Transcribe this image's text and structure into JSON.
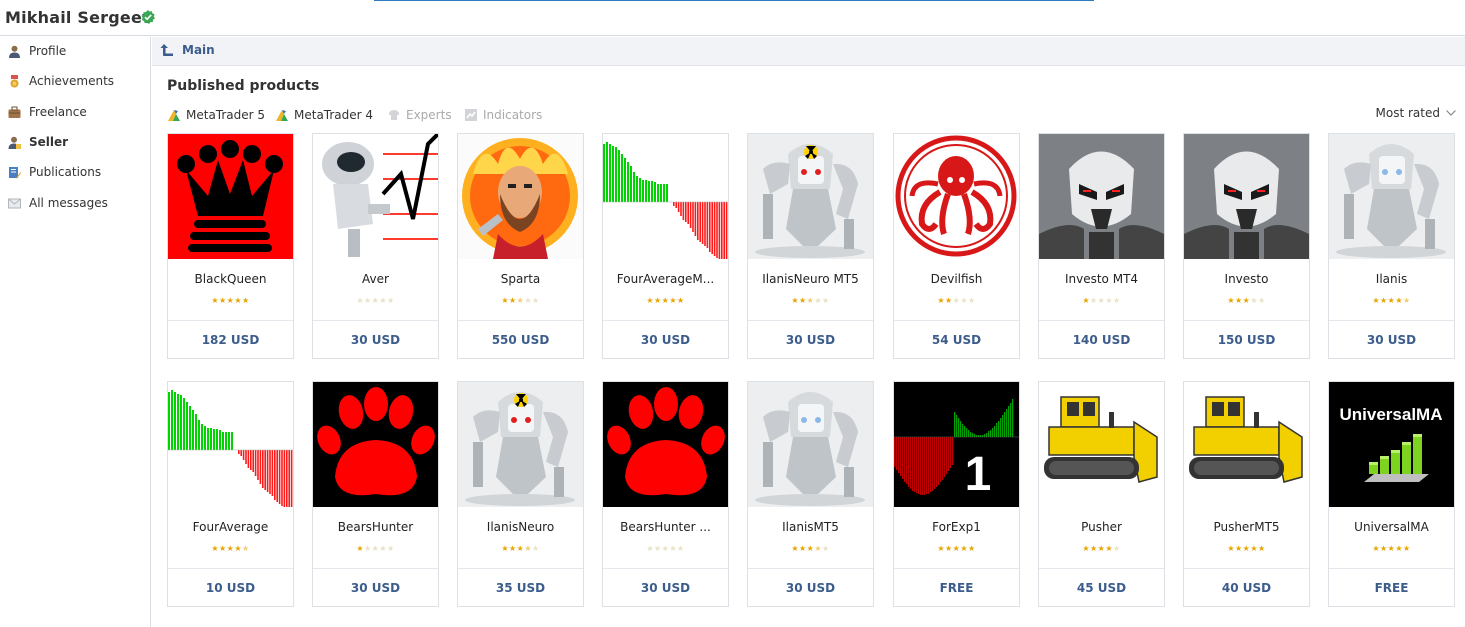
{
  "header": {
    "user_name": "Mikhail Sergeev"
  },
  "sidebar": {
    "items": [
      {
        "label": "Profile",
        "icon": "profile-icon",
        "active": false
      },
      {
        "label": "Achievements",
        "icon": "medal-icon",
        "active": false
      },
      {
        "label": "Freelance",
        "icon": "briefcase-icon",
        "active": false
      },
      {
        "label": "Seller",
        "icon": "seller-icon",
        "active": true
      },
      {
        "label": "Publications",
        "icon": "publications-icon",
        "active": false
      },
      {
        "label": "All messages",
        "icon": "messages-icon",
        "active": false
      }
    ]
  },
  "breadcrumb": {
    "label": "Main"
  },
  "main": {
    "title": "Published products",
    "filters": [
      {
        "label": "MetaTrader 5",
        "icon": "metatrader-icon",
        "active": true
      },
      {
        "label": "MetaTrader 4",
        "icon": "metatrader-icon",
        "active": true
      },
      {
        "label": "Experts",
        "icon": "experts-icon",
        "active": false
      },
      {
        "label": "Indicators",
        "icon": "indicators-icon",
        "active": false
      }
    ],
    "sort_label": "Most rated",
    "products": [
      {
        "name": "BlackQueen",
        "rating": 5,
        "price": "182 USD",
        "thumb": "crown"
      },
      {
        "name": "Aver",
        "rating": 0,
        "price": "30 USD",
        "thumb": "robot-chart"
      },
      {
        "name": "Sparta",
        "rating": 2.5,
        "price": "550 USD",
        "thumb": "warrior"
      },
      {
        "name": "FourAverageM...",
        "rating": 5,
        "price": "30 USD",
        "thumb": "histogram"
      },
      {
        "name": "IlanisNeuro MT5",
        "rating": 2.5,
        "price": "30 USD",
        "thumb": "robot-radiation"
      },
      {
        "name": "Devilfish",
        "rating": 2,
        "price": "54 USD",
        "thumb": "octopus"
      },
      {
        "name": "Investo MT4",
        "rating": 1,
        "price": "140 USD",
        "thumb": "cyborg"
      },
      {
        "name": "Investo",
        "rating": 3,
        "price": "150 USD",
        "thumb": "cyborg"
      },
      {
        "name": "Ilanis",
        "rating": 4.5,
        "price": "30 USD",
        "thumb": "robot"
      },
      {
        "name": "FourAverage",
        "rating": 4.5,
        "price": "10 USD",
        "thumb": "histogram"
      },
      {
        "name": "BearsHunter",
        "rating": 1,
        "price": "30 USD",
        "thumb": "paw"
      },
      {
        "name": "IlanisNeuro",
        "rating": 3.5,
        "price": "35 USD",
        "thumb": "robot-radiation"
      },
      {
        "name": "BearsHunter ...",
        "rating": 0,
        "price": "30 USD",
        "thumb": "paw"
      },
      {
        "name": "IlanisMT5",
        "rating": 3.5,
        "price": "30 USD",
        "thumb": "robot"
      },
      {
        "name": "ForExp1",
        "rating": 5,
        "price": "FREE",
        "thumb": "forexp"
      },
      {
        "name": "Pusher",
        "rating": 4,
        "price": "45 USD",
        "thumb": "bulldozer"
      },
      {
        "name": "PusherMT5",
        "rating": 5,
        "price": "40 USD",
        "thumb": "bulldozer"
      },
      {
        "name": "UniversalMA",
        "rating": 5,
        "price": "FREE",
        "thumb": "universalma"
      }
    ]
  },
  "colors": {
    "link": "#3c5d8c",
    "star": "#e5a600",
    "verified": "#3aa757"
  },
  "thumb_text": {
    "universalma": "UniversalMA",
    "forexp": "1"
  }
}
